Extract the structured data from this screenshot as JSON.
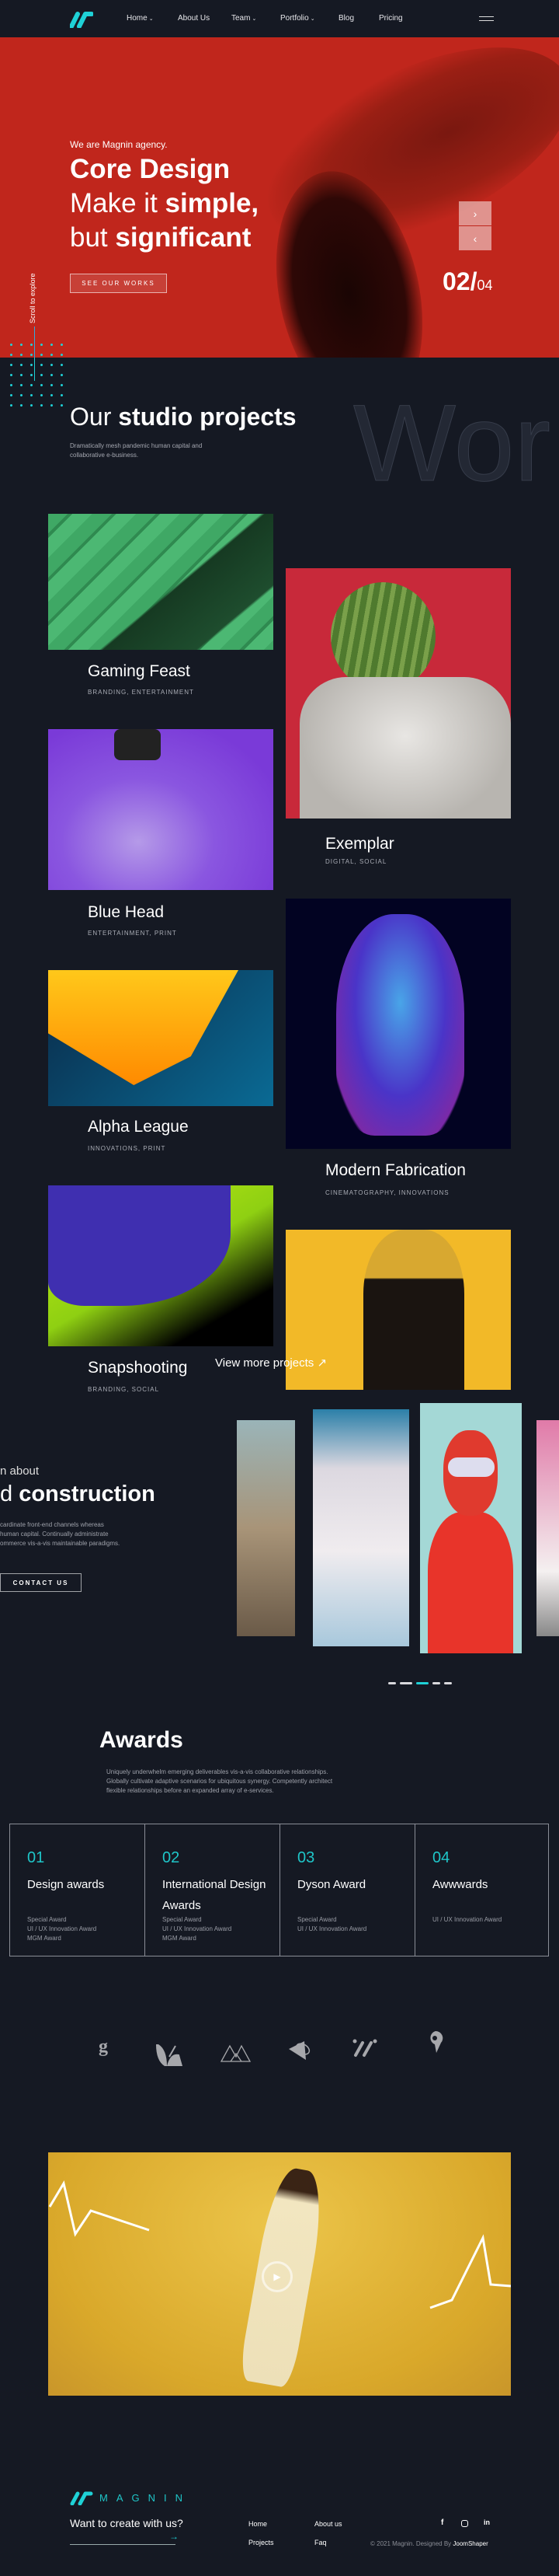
{
  "nav": {
    "items": [
      {
        "label": "Home",
        "dropdown": true
      },
      {
        "label": "About Us",
        "dropdown": false
      },
      {
        "label": "Team",
        "dropdown": true
      },
      {
        "label": "Portfolio",
        "dropdown": true
      },
      {
        "label": "Blog",
        "dropdown": false
      },
      {
        "label": "Pricing",
        "dropdown": false
      }
    ],
    "menu_icon": "hamburger-icon"
  },
  "hero": {
    "tagline": "We are Magnin agency.",
    "title": "Core Design",
    "line2_light": "Make it ",
    "line2_bold": "simple,",
    "line3_light": "but ",
    "line3_bold": "significant",
    "cta": "SEE OUR WORKS",
    "slide_current": "02/",
    "slide_total": "04",
    "scroll_text": "Scroll to explore",
    "next_icon": "chevron-right-icon",
    "prev_icon": "chevron-left-icon",
    "bg_color": "#c0261c"
  },
  "projects": {
    "heading_light": "Our ",
    "heading_bold": "studio projects",
    "description": "Dramatically mesh pandemic human capital and collaborative e-business.",
    "bg_word": "Wor",
    "items": [
      {
        "title": "Gaming Feast",
        "tags": "BRANDING, ENTERTAINMENT"
      },
      {
        "title": "Exemplar",
        "tags": "DIGITAL, SOCIAL"
      },
      {
        "title": "Blue Head",
        "tags": "ENTERTAINMENT, PRINT"
      },
      {
        "title": "Modern Fabrication",
        "tags": "CINEMATOGRAPHY, INNOVATIONS"
      },
      {
        "title": "Alpha League",
        "tags": "INNOVATIONS, PRINT"
      },
      {
        "title": "Snapshooting",
        "tags": "BRANDING, SOCIAL"
      }
    ],
    "view_more": "View more projects ↗"
  },
  "about": {
    "kicker": "n about",
    "heading_light": "d ",
    "heading_bold": "construction",
    "paragraph": [
      "cardinate front-end channels whereas",
      "human capital. Continually administrate",
      "ommerce vis-a-vis maintainable paradigms."
    ],
    "cta": "CONTACT US",
    "slider_active_index": 2,
    "slider_count": 5
  },
  "awards": {
    "title": "Awards",
    "description": "Uniquely underwhelm emerging deliverables vis-a-vis collaborative relationships. Globally cultivate adaptive scenarios for ubiquitous synergy. Competently architect flexible relationships before an expanded array of e-services.",
    "items": [
      {
        "num": "01",
        "title": "Design awards",
        "lines": [
          "Special Award",
          "UI / UX Innovation Award",
          "MGM Award"
        ]
      },
      {
        "num": "02",
        "title": "International Design Awards",
        "lines": [
          "Special Award",
          "UI / UX Innovation Award",
          "MGM Award"
        ]
      },
      {
        "num": "03",
        "title": "Dyson Award",
        "lines": [
          "Special Award",
          "UI / UX Innovation Award"
        ]
      },
      {
        "num": "04",
        "title": "Awwwards",
        "lines": [
          "UI / UX Innovation Award"
        ]
      }
    ]
  },
  "clients": [
    "g-logo-icon",
    "leaf-logo-icon",
    "mountain-logo-icon",
    "star-orbit-logo-icon",
    "slashes-logo-icon",
    "pin-logo-icon"
  ],
  "video": {
    "play_icon": "play-icon"
  },
  "footer": {
    "brand": "MAGNIN",
    "cta": "Want to create with us?",
    "links": [
      "Home",
      "About us",
      "Projects",
      "Faq"
    ],
    "social": [
      "facebook-icon",
      "instagram-icon",
      "linkedin-icon"
    ],
    "copyright": "© 2021 Magnin. Designed By ",
    "designer": "JoomShaper"
  },
  "colors": {
    "accent": "#1fd1d6",
    "background": "#151923",
    "hero": "#c0261c"
  }
}
